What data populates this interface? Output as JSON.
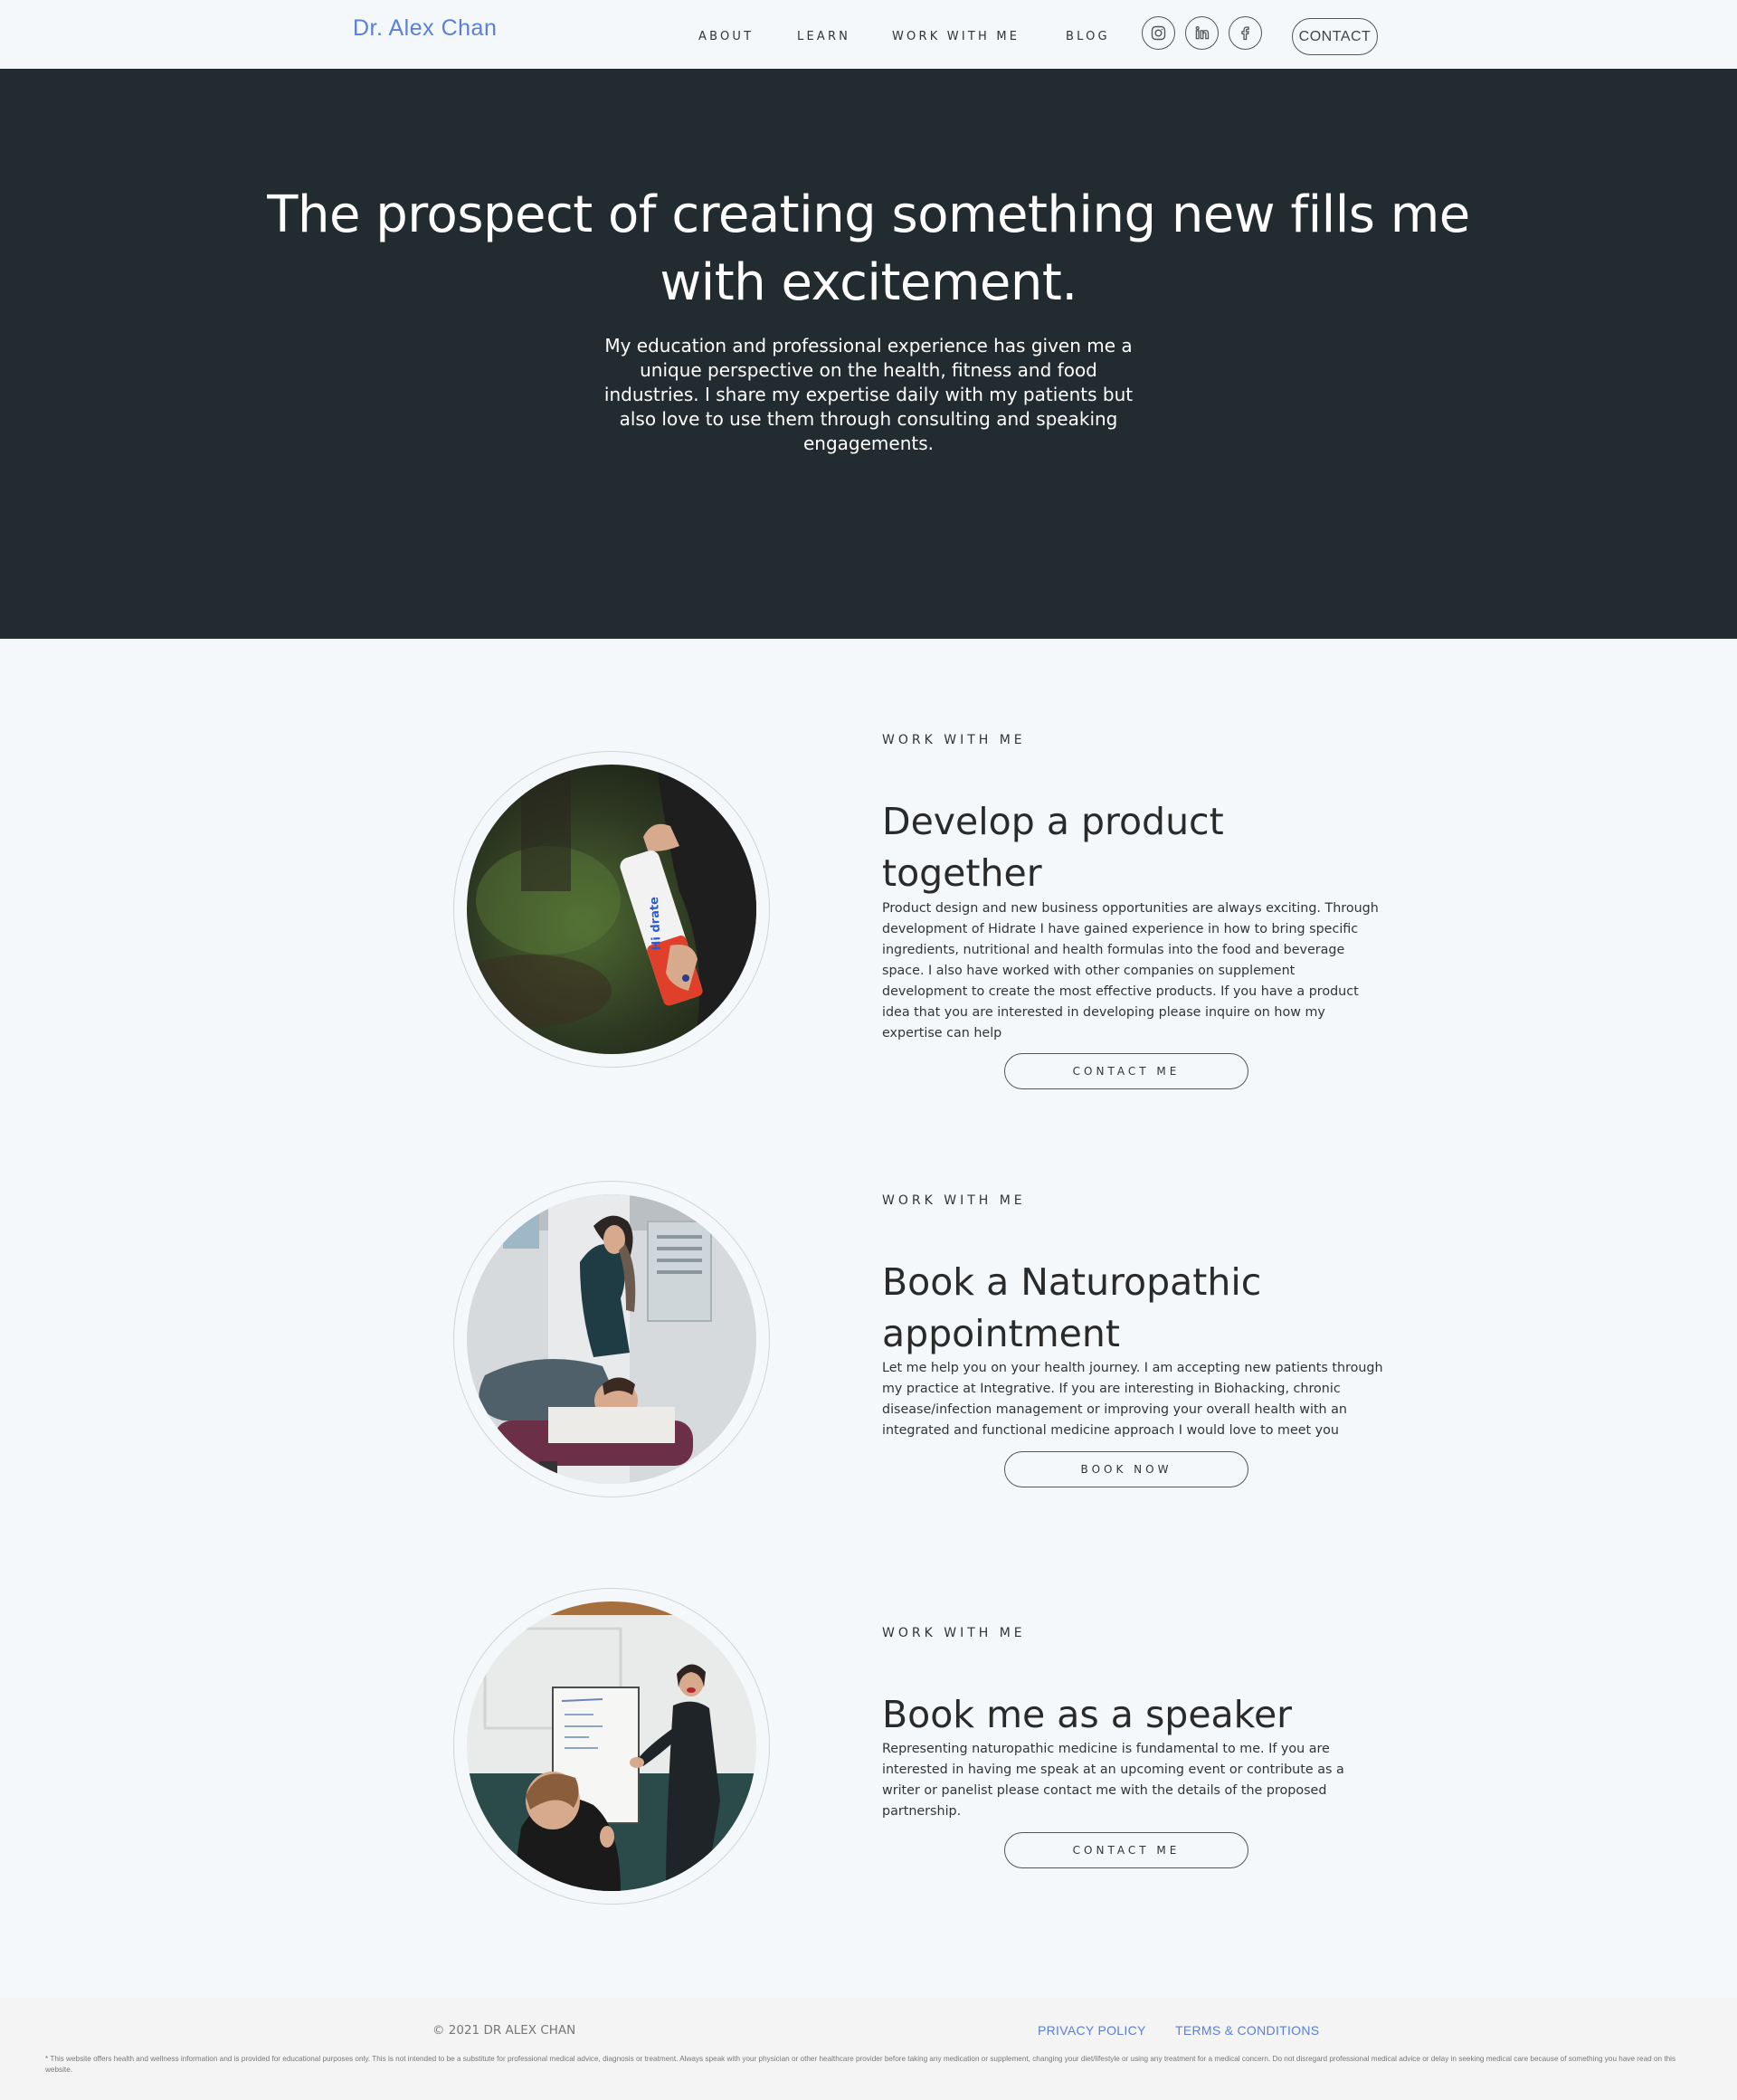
{
  "header": {
    "logo": "Dr. Alex Chan",
    "nav": [
      "ABOUT",
      "LEARN",
      "WORK WITH ME",
      "BLOG"
    ],
    "social_icons": [
      "instagram-icon",
      "linkedin-icon",
      "facebook-icon"
    ],
    "contact_label": "CONTACT"
  },
  "hero": {
    "title": "The prospect of creating something new fills me with excitement.",
    "text": "My education and professional experience has given me a unique perspective on the health, fitness and food industries. I share my expertise daily with my patients but also love to use them through consulting and speaking engagements."
  },
  "sections": [
    {
      "eyebrow": "WORK WITH ME",
      "title": "Develop a product together",
      "body": "Product design and new business opportunities are always exciting. Through development of Hidrate I have gained experience in how to bring specific ingredients, nutritional and health formulas into the food and beverage space. I also have worked with other companies on supplement development to create the most effective products. If you have a product idea that you are interested in developing please inquire on how my expertise can help",
      "button": "CONTACT ME",
      "image_text": "Hi drate"
    },
    {
      "eyebrow": "WORK WITH ME",
      "title": "Book a Naturopathic appointment",
      "body": "Let me help you on your health journey. I am accepting new patients through my practice at Integrative. If you are interesting in Biohacking, chronic disease/infection management or improving your overall health with an integrated and functional medicine approach I would love to meet you",
      "button": "BOOK NOW"
    },
    {
      "eyebrow": "WORK WITH ME",
      "title": "Book me as a speaker",
      "body": "Representing naturopathic medicine is fundamental to me. If you are interested in having me speak at an upcoming event or contribute as a writer or panelist please contact me with the details of the proposed partnership.",
      "button": "CONTACT ME"
    }
  ],
  "footer": {
    "copyright": "© 2021 DR ALEX CHAN",
    "privacy": "PRIVACY POLICY",
    "terms": "TERMS & CONDITIONS",
    "disclaimer": "* This website offers health and wellness information and is provided for educational purposes only. This is not intended to be a substitute for professional medical advice, diagnosis or treatment. Always speak with your physician or other healthcare provider before taking any medication or supplement, changing your diet/lifestyle or using any treatment for a medical concern. Do not disregard professional medical advice or delay in seeking medical care because of something you have read on this website."
  }
}
